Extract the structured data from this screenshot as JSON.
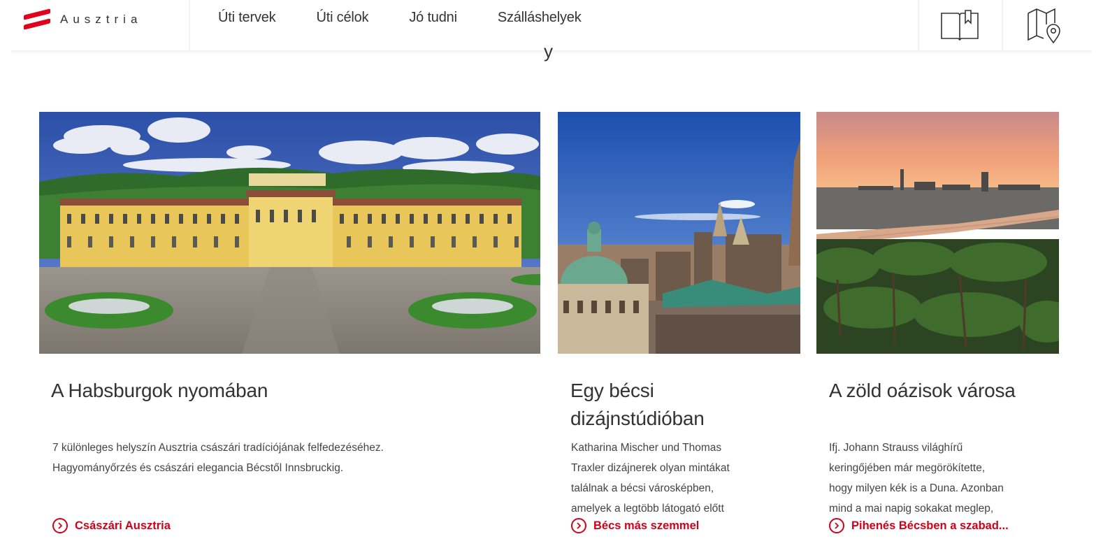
{
  "header": {
    "logo_text": "Ausztria",
    "nav": [
      "Úti tervek",
      "Úti célok",
      "Jó tudni",
      "Szálláshelyek"
    ],
    "icons": [
      "guide-book-icon",
      "map-pin-icon"
    ],
    "heading_fragment": "y"
  },
  "cards": [
    {
      "image": "schonbrunn-palace-photo",
      "title": "A Habsburgok nyomában",
      "text_lines": [
        "7 különleges helyszín Ausztria császári tradíciójának felfedezéséhez.",
        "Hagyományőrzés és császári elegancia Bécstől Innsbruckig."
      ],
      "link": "Császári Ausztria"
    },
    {
      "image": "vienna-rooftops-photo",
      "title_lines": [
        "Egy bécsi",
        "dizájnstúdióban"
      ],
      "text_lines": [
        "Katharina Mischer und Thomas",
        "Traxler dizájnerek olyan mintákat",
        "találnak a bécsi városképben,",
        "amelyek a legtöbb látogató előtt"
      ],
      "link": "Bécs más szemmel"
    },
    {
      "image": "vienna-vineyards-danube-photo",
      "title": "A zöld oázisok városa",
      "text_lines": [
        "Ifj. Johann Strauss világhírű",
        "keringőjében már megörökítette,",
        "hogy milyen kék is a Duna. Azonban",
        "mind a mai napig sokakat meglep,"
      ],
      "link": "Pihenés Bécsben a szabad..."
    }
  ],
  "colors": {
    "brand_red": "#e2001a",
    "link_red": "#d0011b",
    "text": "#333333"
  }
}
